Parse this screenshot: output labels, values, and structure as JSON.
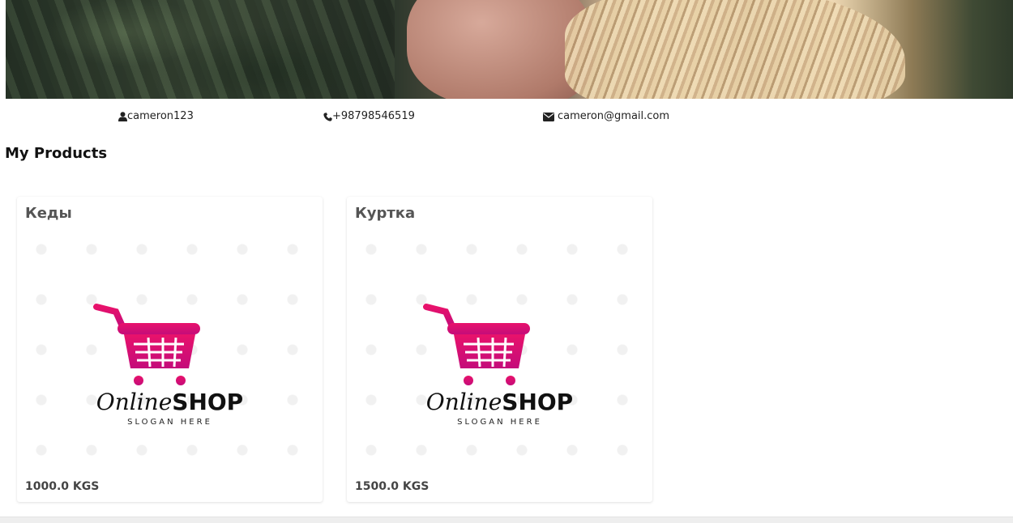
{
  "profile": {
    "username": "cameron123",
    "phone": "+98798546519",
    "email": "cameron@gmail.com"
  },
  "icons": {
    "user": "user-icon",
    "phone": "phone-icon",
    "email": "envelope-icon",
    "cart": "shopping-cart-icon"
  },
  "section_title": "My Products",
  "products": [
    {
      "name": "Кеды",
      "price": "1000.0 KGS"
    },
    {
      "name": "Куртка",
      "price": "1500.0 KGS"
    }
  ],
  "product_image": {
    "logo_script": "Online",
    "logo_bold": "SHOP",
    "slogan": "SLOGAN HERE"
  },
  "colors": {
    "cart_gradient_start": "#e8126b",
    "cart_gradient_end": "#c40c7a"
  }
}
